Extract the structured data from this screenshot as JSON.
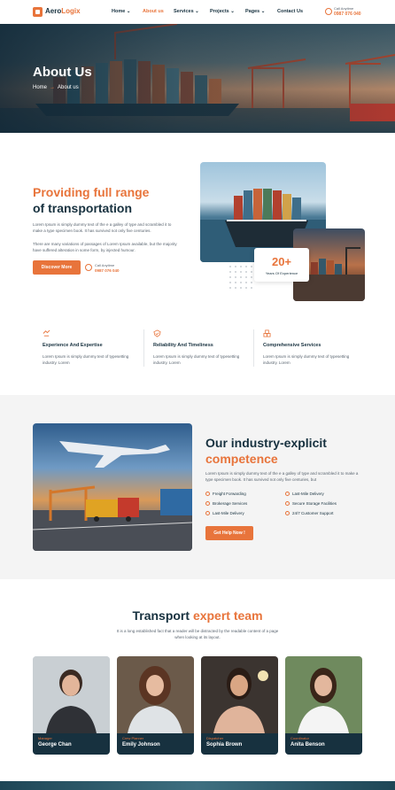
{
  "brand": {
    "name_main": "Aero",
    "name_accent": "Logix"
  },
  "nav": [
    {
      "label": "Home",
      "has_dropdown": true
    },
    {
      "label": "About us",
      "has_dropdown": false,
      "active": true
    },
    {
      "label": "Services",
      "has_dropdown": true
    },
    {
      "label": "Projects",
      "has_dropdown": true
    },
    {
      "label": "Pages",
      "has_dropdown": true
    },
    {
      "label": "Contact Us",
      "has_dropdown": false
    }
  ],
  "header_call": {
    "label": "Call Anytime",
    "number": "0987 076 040"
  },
  "hero": {
    "title": "About Us",
    "crumb_home": "Home",
    "crumb_arrow": "→",
    "crumb_current": "About us"
  },
  "intro": {
    "title_line1": "Providing full range",
    "title_line2": "of transportation",
    "para1": "Lorem Ipsum is simply dummy text of the e a galley of type and scrambled it to make a type specimen book. It has survived not only five centuries.",
    "para2": "There are many variations of passages of Lorem Ipsum available, but the majority have suffered alteration in some form, by injected humour.",
    "button": "Discover More",
    "call_label": "Call Anytime",
    "call_number": "0987 076 040",
    "stat_number": "20+",
    "stat_label": "Years Of Experience"
  },
  "features": [
    {
      "icon": "handshake-icon",
      "title": "Experience And Expertise",
      "text": "Lorem Ipsum is simply dummy text of typesetting industry. Lorem"
    },
    {
      "icon": "shield-check-icon",
      "title": "Reliability And Timeliness",
      "text": "Lorem Ipsum is simply dummy text of typesetting industry. Lorem"
    },
    {
      "icon": "boxes-icon",
      "title": "Comprehensive Services",
      "text": "Lorem Ipsum is simply dummy text of typesetting industry. Lorem"
    }
  ],
  "industry": {
    "title_line1": "Our industry-explicit",
    "title_line2": "competence",
    "para": "Lorem Ipsum is simply dummy text of the e a galley of type and scrambled it to make a type specimen book. It has survived not only five centuries, but",
    "checks_left": [
      "Freight Forwarding",
      "Brokerage Services",
      "Last-Mile Delivery"
    ],
    "checks_right": [
      "Last-Mile Delivery",
      "Secure Storage Facilities",
      "24/7 Customer Support"
    ],
    "button": "Get Help Now !"
  },
  "team": {
    "title_main": "Transport",
    "title_accent": "expert team",
    "subtitle": "It is a long established fact that a reader will be distracted by the readable content of a page when looking at its layout.",
    "members": [
      {
        "role": "Manager",
        "name": "George Chan"
      },
      {
        "role": "Crew Planner",
        "name": "Emily Johnson"
      },
      {
        "role": "Dispatcher",
        "name": "Sophia Brown"
      },
      {
        "role": "Coordinator",
        "name": "Anita Benson"
      }
    ]
  },
  "colors": {
    "accent": "#e8743b",
    "dark": "#17313f"
  }
}
